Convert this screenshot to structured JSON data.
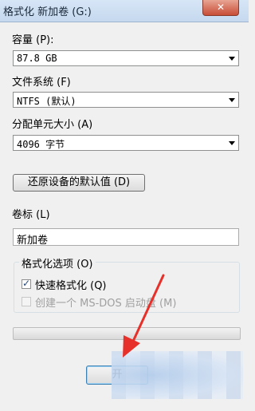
{
  "window": {
    "title": "格式化 新加卷 (G:)",
    "close_icon": "close-icon"
  },
  "capacity": {
    "label": "容量 (P):",
    "value": "87.8 GB"
  },
  "filesystem": {
    "label": "文件系统 (F)",
    "value": "NTFS (默认)"
  },
  "allocation": {
    "label": "分配单元大小 (A)",
    "value": "4096 字节"
  },
  "restore_button": "还原设备的默认值 (D)",
  "volume_label": {
    "label": "卷标 (L)",
    "value": "新加卷"
  },
  "format_options": {
    "title": "格式化选项 (O)",
    "quick_format": {
      "label": "快速格式化 (Q)",
      "checked": true
    },
    "msdos_boot": {
      "label": "创建一个 MS-DOS 启动盘 (M)",
      "checked": false,
      "disabled": true
    }
  },
  "progress": {
    "value": 0
  },
  "start_button": "开",
  "annotation": {
    "color": "#e8302a",
    "icon": "red-arrow-icon"
  }
}
